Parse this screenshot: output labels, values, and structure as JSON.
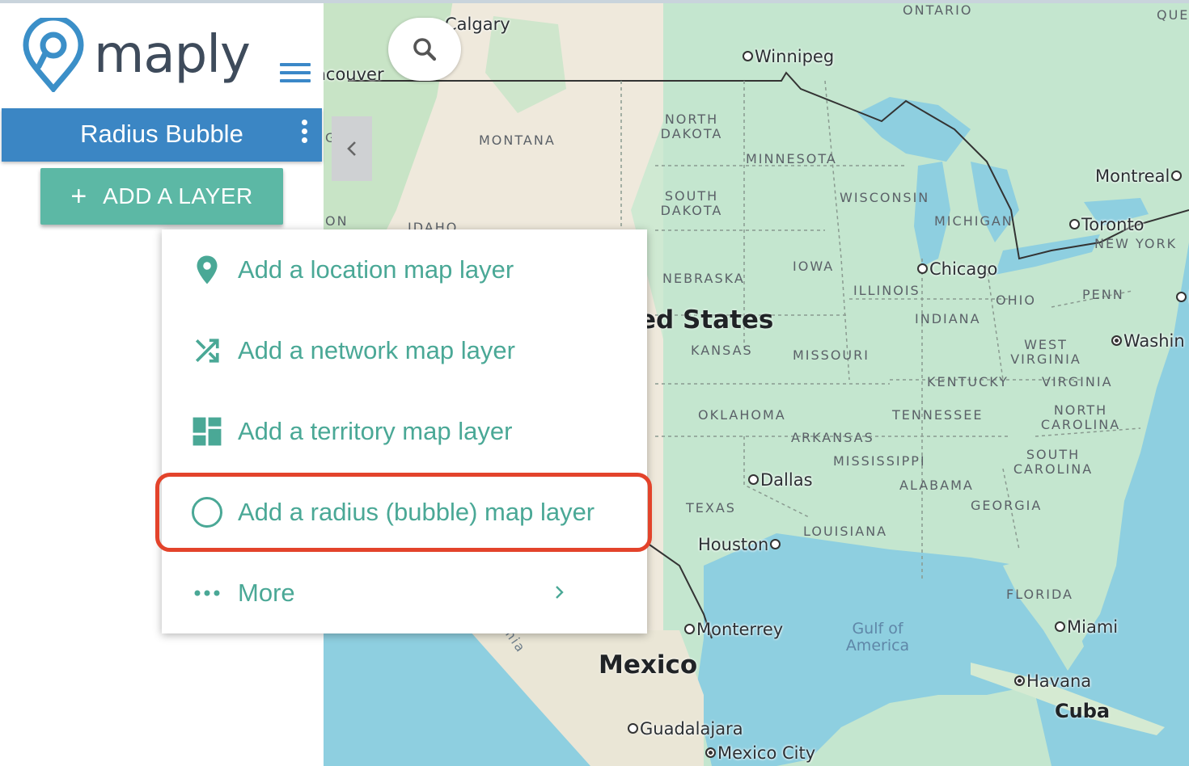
{
  "app": {
    "logo_text": "maply",
    "layer_name": "Radius Bubble",
    "add_layer_label": "ADD A LAYER",
    "accent_color": "#3b86c4",
    "button_color": "#5cb8a5",
    "menu_text_color": "#4aa896",
    "highlight_color": "#e3432b"
  },
  "menu": {
    "items": [
      {
        "label": "Add a location map layer",
        "icon": "location-pin-icon"
      },
      {
        "label": "Add a network map layer",
        "icon": "shuffle-icon"
      },
      {
        "label": "Add a territory map layer",
        "icon": "dashboard-icon"
      },
      {
        "label": "Add a radius (bubble) map layer",
        "icon": "circle-outline-icon"
      },
      {
        "label": "More",
        "icon": "more-horizontal-icon"
      }
    ]
  },
  "map": {
    "states": [
      "ONTARIO",
      "QUE",
      "NORTH DAKOTA",
      "MONTANA",
      "MINNESOTA",
      "SOUTH DAKOTA",
      "WISCONSIN",
      "MICHIGAN",
      "NEW YORK",
      "IOWA",
      "NEBRASKA",
      "ILLINOIS",
      "OHIO",
      "PENN",
      "INDIANA",
      "KANSAS",
      "MISSOURI",
      "WEST VIRGINIA",
      "KENTUCKY",
      "VIRGINIA",
      "OKLAHOMA",
      "TENNESSEE",
      "NORTH CAROLINA",
      "ARKANSAS",
      "MISSISSIPPI",
      "SOUTH CAROLINA",
      "ALABAMA",
      "GEORGIA",
      "TEXAS",
      "LOUISIANA",
      "FLORIDA",
      "ON",
      "IDAHO"
    ],
    "cities": [
      "Calgary",
      "Winnipeg",
      "Vancouver",
      "Montreal",
      "Toronto",
      "Chicago",
      "Washin",
      "Dallas",
      "Houston",
      "Monterrey",
      "Miami",
      "Havana",
      "Guadalajara",
      "Mexico City"
    ],
    "countries": [
      "ed States",
      "Mexico",
      "Cuba"
    ],
    "water": "Gulf of America",
    "misc": [
      "G",
      "N",
      "nia"
    ]
  }
}
